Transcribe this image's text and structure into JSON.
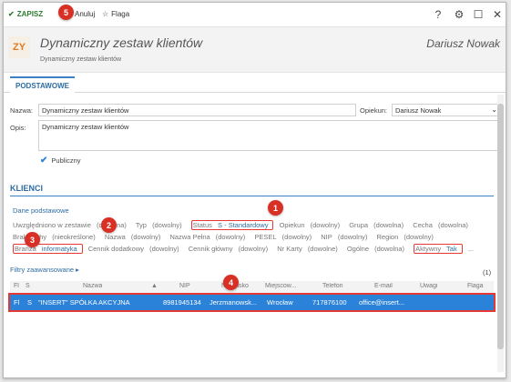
{
  "toolbar": {
    "save_label": "ZAPISZ",
    "cancel_label": "Anuluj",
    "flag_label": "Flaga"
  },
  "header": {
    "avatar": "ZY",
    "title": "Dynamiczny zestaw klientów",
    "subtitle": "Dynamiczny zestaw klientów",
    "owner": "Dariusz Nowak"
  },
  "tabs": [
    "PODSTAWOWE"
  ],
  "form": {
    "name_label": "Nazwa:",
    "name_value": "Dynamiczny zestaw klientów",
    "guardian_label": "Opiekun:",
    "guardian_value": "Dariusz Nowak",
    "desc_label": "Opis:",
    "desc_value": "Dynamiczny zestaw klientów",
    "public_label": "Publiczny",
    "public_checked": true
  },
  "clients": {
    "section_title": "KLIENCI",
    "basic_data_link": "Dane podstawowe",
    "filters": [
      {
        "label": "Uwzględniono w zestawie",
        "value": "(dowolna)"
      },
      {
        "label": "Typ",
        "value": "(dowolny)"
      },
      {
        "label": "Status",
        "value": "S - Standardowy"
      },
      {
        "label": "Opiekun",
        "value": "(dowolny)"
      },
      {
        "label": "Grupa",
        "value": "(dowolna)"
      },
      {
        "label": "Cecha",
        "value": "(dowolna)"
      },
      {
        "label": "Brak cechy",
        "value": "(nieokreślone)"
      },
      {
        "label": "Nazwa",
        "value": "(dowolny)"
      },
      {
        "label": "Nazwa Pełna",
        "value": "(dowolny)"
      },
      {
        "label": "PESEL",
        "value": "(dowolny)"
      },
      {
        "label": "NIP",
        "value": "(dowolny)"
      },
      {
        "label": "Region",
        "value": "(dowolny)"
      },
      {
        "label": "Branża",
        "value": "informatyka"
      },
      {
        "label": "Cennik dodatkowy",
        "value": "(dowolny)"
      },
      {
        "label": "Cennik główny",
        "value": "(dowolny)"
      },
      {
        "label": "Nr Karty",
        "value": "(dowolne)"
      },
      {
        "label": "Ogólne",
        "value": "(dowolna)"
      },
      {
        "label": "Aktywny",
        "value": "Tak"
      }
    ],
    "more": "...",
    "advanced_link": "Filtry zaawansowane",
    "count": "(1)",
    "columns": [
      "Fl",
      "S",
      "Nazwa",
      "NIP",
      "Nazwisko",
      "Miejscow...",
      "Telefon",
      "E-mail",
      "Uwagi",
      "Flaga"
    ],
    "rows": [
      [
        "Fl",
        "S",
        "\"INSERT\" SPÓŁKA AKCYJNA",
        "8981945134",
        "Jerzmanowsk...",
        "Wrocław",
        "717876100",
        "office@insert...",
        "",
        ""
      ]
    ]
  },
  "markers": [
    "1",
    "2",
    "3",
    "4",
    "5"
  ]
}
